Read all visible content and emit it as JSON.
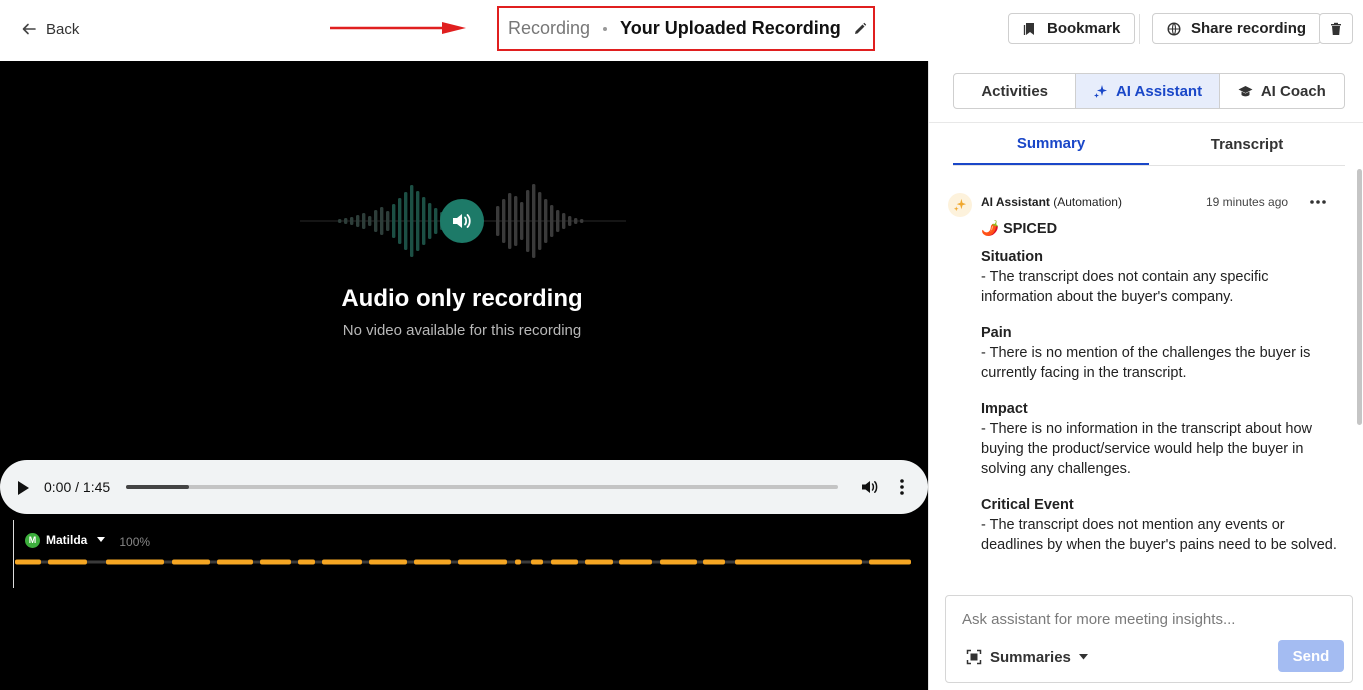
{
  "header": {
    "back_label": "Back",
    "crumb": "Recording",
    "title": "Your Uploaded Recording",
    "bookmark_label": "Bookmark",
    "share_label": "Share recording"
  },
  "player": {
    "title": "Audio only recording",
    "subtitle": "No video available for this recording",
    "time": "0:00 / 1:45",
    "progress_fraction": 0.088,
    "speaker": {
      "initial": "M",
      "name": "Matilda",
      "percent": "100%",
      "color": "#3cae3c"
    }
  },
  "panel": {
    "segments": [
      {
        "label": "Activities",
        "icon": "none"
      },
      {
        "label": "AI Assistant",
        "icon": "sparkle-icon"
      },
      {
        "label": "AI Coach",
        "icon": "graduation-cap-icon"
      }
    ],
    "tabs": [
      "Summary",
      "Transcript"
    ],
    "message": {
      "author": "AI Assistant",
      "author_suffix": "(Automation)",
      "time_ago": "19 minutes ago",
      "framework_emoji": "🌶️",
      "framework": "SPICED",
      "sections": [
        {
          "heading": "Situation",
          "text": "- The transcript does not contain any specific information about the buyer's company."
        },
        {
          "heading": "Pain",
          "text": "- There is no mention of the challenges the buyer is currently facing in the transcript."
        },
        {
          "heading": "Impact",
          "text": "- There is no information in the transcript about how buying the product/service would help the buyer in solving any challenges."
        },
        {
          "heading": "Critical Event",
          "text": "- The transcript does not mention any events or deadlines by when the buyer's pains need to be solved."
        }
      ]
    },
    "composer": {
      "placeholder": "Ask assistant for more meeting insights...",
      "summaries_label": "Summaries",
      "send_label": "Send"
    }
  },
  "colors": {
    "accent": "#1a47c8",
    "annotation_red": "#e01f1f",
    "audio_teal": "#1d7a68",
    "timeline_orange": "#f5a623"
  }
}
